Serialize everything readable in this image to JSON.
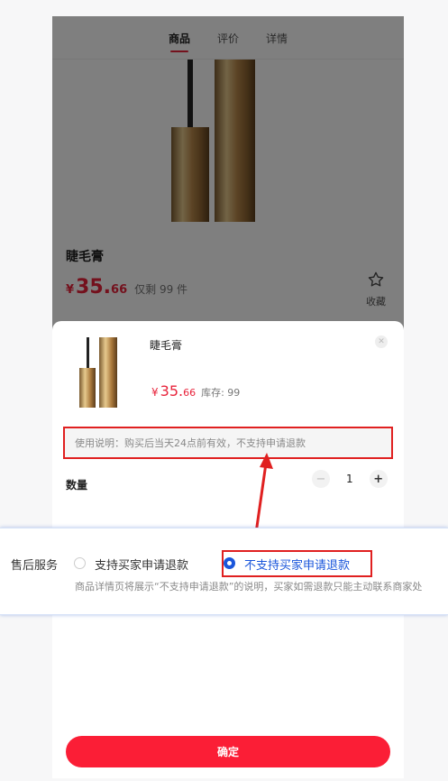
{
  "tabs": [
    {
      "label": "商品",
      "active": true
    },
    {
      "label": "评价",
      "active": false
    },
    {
      "label": "详情",
      "active": false
    }
  ],
  "product": {
    "title": "睫毛膏",
    "currency": "¥",
    "price_int": "35.",
    "price_dec": "66",
    "stock_text": "仅剩 99 件",
    "favorite_label": "收藏"
  },
  "sheet": {
    "title": "睫毛膏",
    "currency": "¥",
    "price_int": "35.",
    "price_dec": "66",
    "stock_text": "库存: 99",
    "usage_note": "使用说明：购买后当天24点前有效，不支持申请退款",
    "quantity_label": "数量",
    "quantity_value": "1",
    "minus": "−",
    "plus": "+",
    "confirm_label": "确定"
  },
  "after_sales": {
    "label": "售后服务",
    "option_1": "支持买家申请退款",
    "option_2": "不支持买家申请退款",
    "selected": "option_2",
    "hint": "商品详情页将展示“不支持申请退款”的说明，买家如需退款只能主动联系商家处"
  },
  "colors": {
    "accent_red": "#fb1e36",
    "price_red": "#e8233b",
    "highlight_box": "#e02020",
    "radio_blue": "#1a56db"
  }
}
